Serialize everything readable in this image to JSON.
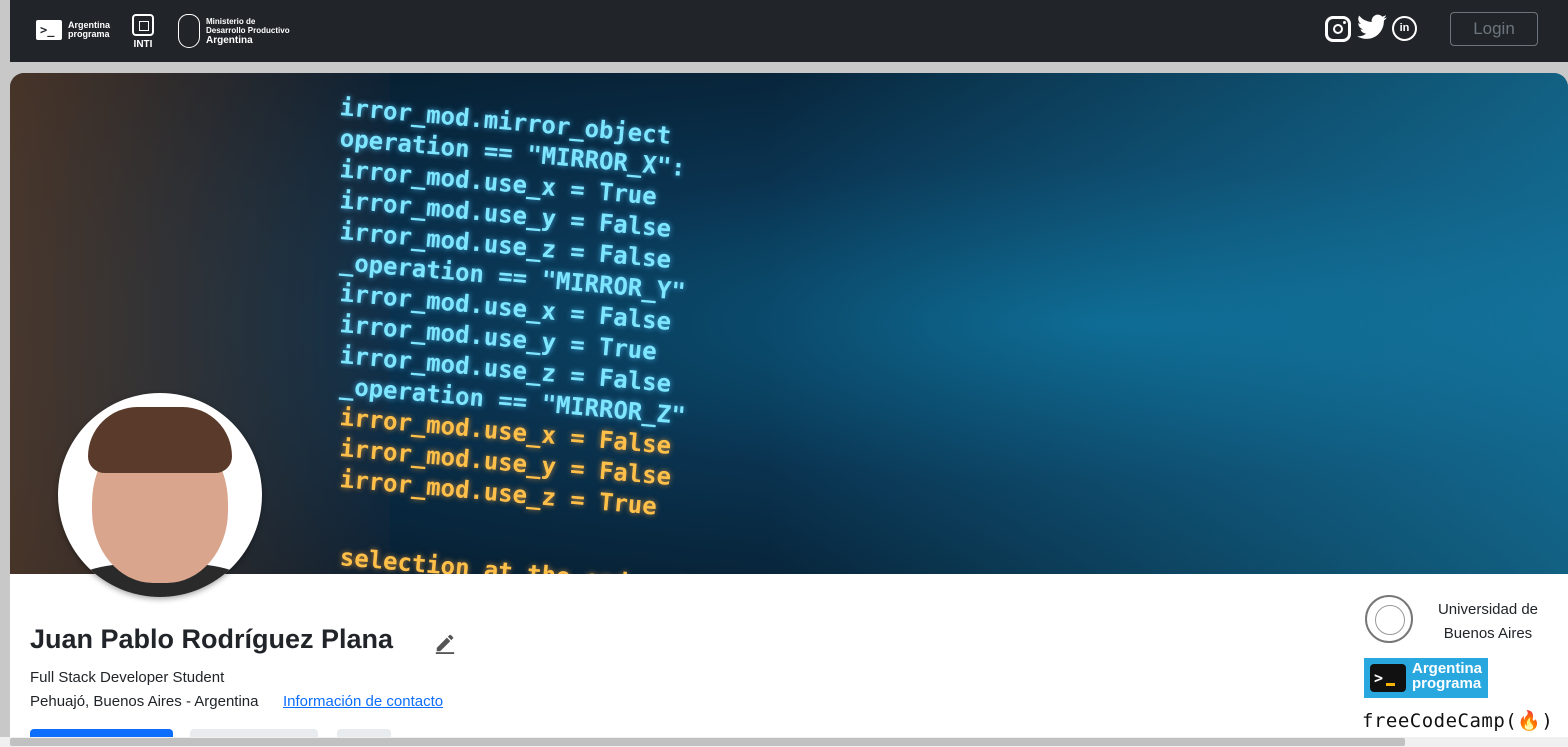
{
  "navbar": {
    "brand_argentina_programa": [
      "Argentina",
      "programa"
    ],
    "brand_inti": "INTI",
    "brand_ministerio": [
      "Ministerio de",
      "Desarrollo Productivo",
      "Argentina"
    ],
    "social_icons": [
      "instagram-icon",
      "twitter-icon",
      "linkedin-icon"
    ],
    "linkedin_glyph": "in",
    "login_label": "Login"
  },
  "banner": {
    "code_lines": [
      {
        "text": "irror_mod.mirror_object",
        "tone": "cyan"
      },
      {
        "text": "operation == \"MIRROR_X\":",
        "tone": "cyan"
      },
      {
        "text": "irror_mod.use_x = True",
        "tone": "cyan"
      },
      {
        "text": "irror_mod.use_y = False",
        "tone": "cyan"
      },
      {
        "text": "irror_mod.use_z = False",
        "tone": "cyan"
      },
      {
        "text": "_operation == \"MIRROR_Y\"",
        "tone": "cyan"
      },
      {
        "text": "irror_mod.use_x = False",
        "tone": "cyan"
      },
      {
        "text": "irror_mod.use_y = True",
        "tone": "cyan"
      },
      {
        "text": "irror_mod.use_z = False",
        "tone": "cyan"
      },
      {
        "text": "_operation == \"MIRROR_Z\"",
        "tone": "cyan"
      },
      {
        "text": "irror_mod.use_x = False",
        "tone": "amber"
      },
      {
        "text": "irror_mod.use_y = False",
        "tone": "amber"
      },
      {
        "text": "irror_mod.use_z = True",
        "tone": "amber"
      },
      {
        "text": "selection at the end -add",
        "tone": "amber"
      }
    ]
  },
  "profile": {
    "name": "Juan Pablo Rodríguez Plana",
    "title": "Full Stack Developer Student",
    "location": "Pehuajó, Buenos Aires - Argentina",
    "contact_link": "Información de contacto"
  },
  "education": {
    "university": [
      "Universidad de",
      "Buenos Aires"
    ],
    "argentina_programa": [
      "Argentina",
      "programa"
    ],
    "freecodecamp": "freeCodeCamp(🔥)"
  },
  "colors": {
    "navbar_bg": "#212529",
    "primary": "#0d6efd",
    "ap_badge": "#29a8e0"
  }
}
